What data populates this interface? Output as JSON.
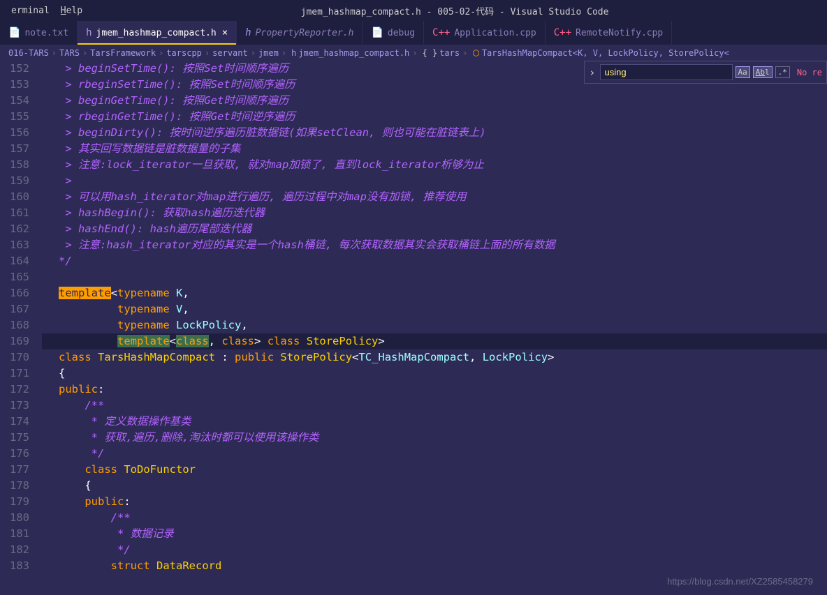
{
  "menubar": {
    "items": [
      "erminal",
      "Help"
    ],
    "title": "jmem_hashmap_compact.h - 005-02-代码 - Visual Studio Code"
  },
  "tabs": [
    {
      "icon": "📄",
      "label": "note.txt",
      "close": false,
      "active": false,
      "italic": false,
      "iconClass": "icon-doc"
    },
    {
      "icon": "h",
      "label": "jmem_hashmap_compact.h",
      "close": true,
      "active": true,
      "italic": false,
      "iconClass": "icon-h"
    },
    {
      "icon": "h",
      "label": "PropertyReporter.h",
      "close": false,
      "active": false,
      "italic": true,
      "iconClass": "icon-h"
    },
    {
      "icon": "📄",
      "label": "debug",
      "close": false,
      "active": false,
      "italic": false,
      "iconClass": "icon-doc"
    },
    {
      "icon": "C++",
      "label": "Application.cpp",
      "close": false,
      "active": false,
      "italic": false,
      "iconClass": "icon-cpp"
    },
    {
      "icon": "C++",
      "label": "RemoteNotify.cpp",
      "close": false,
      "active": false,
      "italic": false,
      "iconClass": "icon-cpp"
    }
  ],
  "breadcrumbs": {
    "parts": [
      "016-TARS",
      "TARS",
      "TarsFramework",
      "tarscpp",
      "servant",
      "jmem",
      "jmem_hashmap_compact.h",
      "tars",
      "TarsHashMapCompact<K, V, LockPolicy, StorePolicy<"
    ]
  },
  "find": {
    "value": "using",
    "no_results": "No re"
  },
  "lines": {
    "start": 152,
    "count": 32,
    "content": [
      {
        "n": 152,
        "cls": "",
        "html": "<span class='comment'> &gt; beginSetTime(): 按照Set时间顺序遍历</span>"
      },
      {
        "n": 153,
        "cls": "",
        "html": "<span class='comment'> &gt; rbeginSetTime(): 按照Set时间顺序遍历</span>"
      },
      {
        "n": 154,
        "cls": "",
        "html": "<span class='comment'> &gt; beginGetTime(): 按照Get时间顺序遍历</span>"
      },
      {
        "n": 155,
        "cls": "",
        "html": "<span class='comment'> &gt; rbeginGetTime(): 按照Get时间逆序遍历</span>"
      },
      {
        "n": 156,
        "cls": "",
        "html": "<span class='comment'> &gt; beginDirty(): 按时间逆序遍历脏数据链(如果setClean, 则也可能在脏链表上)</span>"
      },
      {
        "n": 157,
        "cls": "",
        "html": "<span class='comment'> &gt; 其实回写数据链是脏数据量的子集</span>"
      },
      {
        "n": 158,
        "cls": "",
        "html": "<span class='comment'> &gt; 注意:lock_iterator一旦获取, 就对map加锁了, 直到lock_iterator析够为止</span>"
      },
      {
        "n": 159,
        "cls": "",
        "html": "<span class='comment'> &gt;</span>"
      },
      {
        "n": 160,
        "cls": "",
        "html": "<span class='comment'> &gt; 可以用hash_iterator对map进行遍历, 遍历过程中对map没有加锁, 推荐使用</span>"
      },
      {
        "n": 161,
        "cls": "",
        "html": "<span class='comment'> &gt; hashBegin(): 获取hash遍历迭代器</span>"
      },
      {
        "n": 162,
        "cls": "",
        "html": "<span class='comment'> &gt; hashEnd(): hash遍历尾部迭代器</span>"
      },
      {
        "n": 163,
        "cls": "",
        "html": "<span class='comment'> &gt; 注意:hash_iterator对应的其实是一个hash桶链, 每次获取数据其实会获取桶链上面的所有数据</span>"
      },
      {
        "n": 164,
        "cls": "",
        "html": "<span class='comment'>*/</span>"
      },
      {
        "n": 165,
        "cls": "",
        "html": ""
      },
      {
        "n": 166,
        "cls": "",
        "html": "<span class='hl-orange'>template</span><span class='punct'>&lt;</span><span class='keyword'>typename</span> <span class='type'>K</span><span class='punct'>,</span>"
      },
      {
        "n": 167,
        "cls": "",
        "html": "         <span class='keyword'>typename</span> <span class='type'>V</span><span class='punct'>,</span>"
      },
      {
        "n": 168,
        "cls": "",
        "html": "         <span class='keyword'>typename</span> <span class='type'>LockPolicy</span><span class='punct'>,</span>"
      },
      {
        "n": 169,
        "cls": "current",
        "html": "         <span class='hl-green'><span class='keyword'>template</span></span><span class='punct'>&lt;</span><span class='hl-green'><span class='keyword'>class</span></span><span class='punct'>,</span> <span class='keyword'>class</span><span class='punct'>&gt;</span> <span class='keyword'>class</span> <span class='classname'>StorePolicy</span><span class='punct'>&gt;</span>"
      },
      {
        "n": 170,
        "cls": "",
        "html": "<span class='keyword'>class</span> <span class='classname'>TarsHashMapCompact</span> <span class='punct'>:</span> <span class='keyword'>public</span> <span class='classname'>StorePolicy</span><span class='punct'>&lt;</span><span class='type'>TC_HashMapCompact</span><span class='punct'>,</span> <span class='type'>LockPolicy</span><span class='punct'>&gt;</span>"
      },
      {
        "n": 171,
        "cls": "",
        "html": "<span class='punct'>{</span>"
      },
      {
        "n": 172,
        "cls": "",
        "html": "<span class='keyword'>public</span><span class='punct'>:</span>"
      },
      {
        "n": 173,
        "cls": "",
        "html": "    <span class='comment'>/**</span>"
      },
      {
        "n": 174,
        "cls": "",
        "html": "    <span class='comment'> * 定义数据操作基类</span>"
      },
      {
        "n": 175,
        "cls": "",
        "html": "    <span class='comment'> * 获取,遍历,删除,淘汰时都可以使用该操作类</span>"
      },
      {
        "n": 176,
        "cls": "",
        "html": "    <span class='comment'> */</span>"
      },
      {
        "n": 177,
        "cls": "",
        "html": "    <span class='keyword'>class</span> <span class='classname'>ToDoFunctor</span>"
      },
      {
        "n": 178,
        "cls": "",
        "html": "    <span class='punct'>{</span>"
      },
      {
        "n": 179,
        "cls": "",
        "html": "    <span class='keyword'>public</span><span class='punct'>:</span>"
      },
      {
        "n": 180,
        "cls": "",
        "html": "        <span class='comment'>/**</span>"
      },
      {
        "n": 181,
        "cls": "",
        "html": "        <span class='comment'> * 数据记录</span>"
      },
      {
        "n": 182,
        "cls": "",
        "html": "        <span class='comment'> */</span>"
      },
      {
        "n": 183,
        "cls": "",
        "html": "        <span class='keyword'>struct</span> <span class='classname'>DataRecord</span>"
      }
    ]
  },
  "watermark": "https://blog.csdn.net/XZ2585458279"
}
